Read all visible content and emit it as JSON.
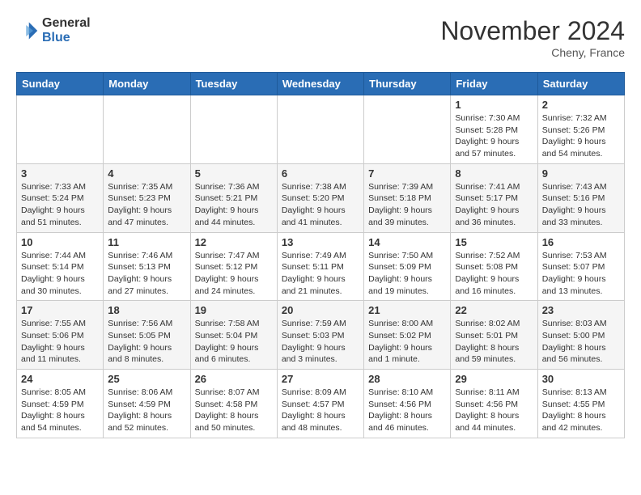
{
  "header": {
    "logo_general": "General",
    "logo_blue": "Blue",
    "month_title": "November 2024",
    "location": "Cheny, France"
  },
  "days_of_week": [
    "Sunday",
    "Monday",
    "Tuesday",
    "Wednesday",
    "Thursday",
    "Friday",
    "Saturday"
  ],
  "weeks": [
    [
      {
        "day": "",
        "info": ""
      },
      {
        "day": "",
        "info": ""
      },
      {
        "day": "",
        "info": ""
      },
      {
        "day": "",
        "info": ""
      },
      {
        "day": "",
        "info": ""
      },
      {
        "day": "1",
        "info": "Sunrise: 7:30 AM\nSunset: 5:28 PM\nDaylight: 9 hours and 57 minutes."
      },
      {
        "day": "2",
        "info": "Sunrise: 7:32 AM\nSunset: 5:26 PM\nDaylight: 9 hours and 54 minutes."
      }
    ],
    [
      {
        "day": "3",
        "info": "Sunrise: 7:33 AM\nSunset: 5:24 PM\nDaylight: 9 hours and 51 minutes."
      },
      {
        "day": "4",
        "info": "Sunrise: 7:35 AM\nSunset: 5:23 PM\nDaylight: 9 hours and 47 minutes."
      },
      {
        "day": "5",
        "info": "Sunrise: 7:36 AM\nSunset: 5:21 PM\nDaylight: 9 hours and 44 minutes."
      },
      {
        "day": "6",
        "info": "Sunrise: 7:38 AM\nSunset: 5:20 PM\nDaylight: 9 hours and 41 minutes."
      },
      {
        "day": "7",
        "info": "Sunrise: 7:39 AM\nSunset: 5:18 PM\nDaylight: 9 hours and 39 minutes."
      },
      {
        "day": "8",
        "info": "Sunrise: 7:41 AM\nSunset: 5:17 PM\nDaylight: 9 hours and 36 minutes."
      },
      {
        "day": "9",
        "info": "Sunrise: 7:43 AM\nSunset: 5:16 PM\nDaylight: 9 hours and 33 minutes."
      }
    ],
    [
      {
        "day": "10",
        "info": "Sunrise: 7:44 AM\nSunset: 5:14 PM\nDaylight: 9 hours and 30 minutes."
      },
      {
        "day": "11",
        "info": "Sunrise: 7:46 AM\nSunset: 5:13 PM\nDaylight: 9 hours and 27 minutes."
      },
      {
        "day": "12",
        "info": "Sunrise: 7:47 AM\nSunset: 5:12 PM\nDaylight: 9 hours and 24 minutes."
      },
      {
        "day": "13",
        "info": "Sunrise: 7:49 AM\nSunset: 5:11 PM\nDaylight: 9 hours and 21 minutes."
      },
      {
        "day": "14",
        "info": "Sunrise: 7:50 AM\nSunset: 5:09 PM\nDaylight: 9 hours and 19 minutes."
      },
      {
        "day": "15",
        "info": "Sunrise: 7:52 AM\nSunset: 5:08 PM\nDaylight: 9 hours and 16 minutes."
      },
      {
        "day": "16",
        "info": "Sunrise: 7:53 AM\nSunset: 5:07 PM\nDaylight: 9 hours and 13 minutes."
      }
    ],
    [
      {
        "day": "17",
        "info": "Sunrise: 7:55 AM\nSunset: 5:06 PM\nDaylight: 9 hours and 11 minutes."
      },
      {
        "day": "18",
        "info": "Sunrise: 7:56 AM\nSunset: 5:05 PM\nDaylight: 9 hours and 8 minutes."
      },
      {
        "day": "19",
        "info": "Sunrise: 7:58 AM\nSunset: 5:04 PM\nDaylight: 9 hours and 6 minutes."
      },
      {
        "day": "20",
        "info": "Sunrise: 7:59 AM\nSunset: 5:03 PM\nDaylight: 9 hours and 3 minutes."
      },
      {
        "day": "21",
        "info": "Sunrise: 8:00 AM\nSunset: 5:02 PM\nDaylight: 9 hours and 1 minute."
      },
      {
        "day": "22",
        "info": "Sunrise: 8:02 AM\nSunset: 5:01 PM\nDaylight: 8 hours and 59 minutes."
      },
      {
        "day": "23",
        "info": "Sunrise: 8:03 AM\nSunset: 5:00 PM\nDaylight: 8 hours and 56 minutes."
      }
    ],
    [
      {
        "day": "24",
        "info": "Sunrise: 8:05 AM\nSunset: 4:59 PM\nDaylight: 8 hours and 54 minutes."
      },
      {
        "day": "25",
        "info": "Sunrise: 8:06 AM\nSunset: 4:59 PM\nDaylight: 8 hours and 52 minutes."
      },
      {
        "day": "26",
        "info": "Sunrise: 8:07 AM\nSunset: 4:58 PM\nDaylight: 8 hours and 50 minutes."
      },
      {
        "day": "27",
        "info": "Sunrise: 8:09 AM\nSunset: 4:57 PM\nDaylight: 8 hours and 48 minutes."
      },
      {
        "day": "28",
        "info": "Sunrise: 8:10 AM\nSunset: 4:56 PM\nDaylight: 8 hours and 46 minutes."
      },
      {
        "day": "29",
        "info": "Sunrise: 8:11 AM\nSunset: 4:56 PM\nDaylight: 8 hours and 44 minutes."
      },
      {
        "day": "30",
        "info": "Sunrise: 8:13 AM\nSunset: 4:55 PM\nDaylight: 8 hours and 42 minutes."
      }
    ]
  ]
}
